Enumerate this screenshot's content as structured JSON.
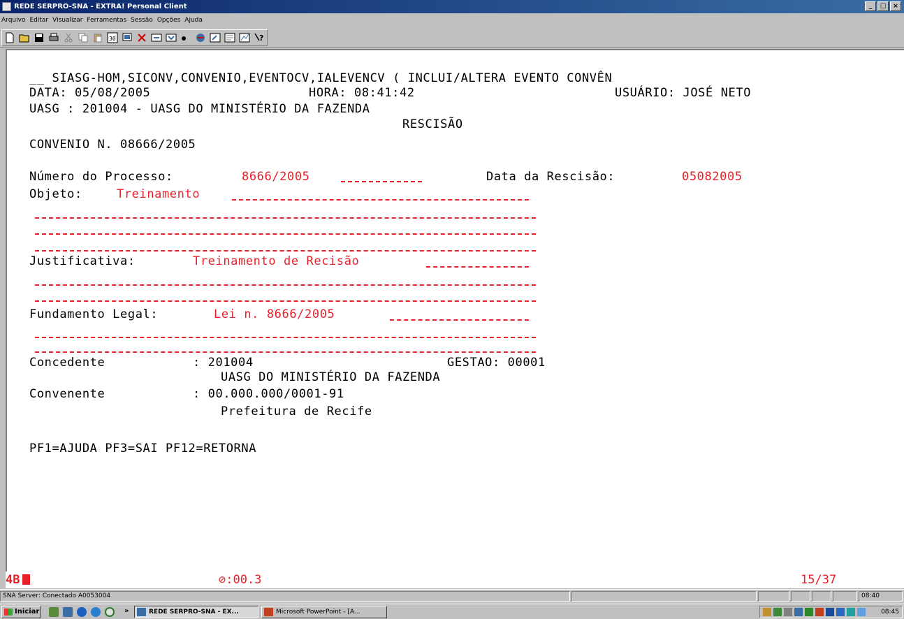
{
  "window": {
    "title": "REDE SERPRO-SNA - EXTRA! Personal Client"
  },
  "menu": [
    "Arquivo",
    "Editar",
    "Visualizar",
    "Ferramentas",
    "Sessão",
    "Opções",
    "Ajuda"
  ],
  "screen": {
    "header1": "__ SIASG-HOM,SICONV,CONVENIO,EVENTOCV,IALEVENCV ( INCLUI/ALTERA EVENTO CONVÊN",
    "date_label": "DATA: 05/08/2005",
    "time_label": "HORA: 08:41:42",
    "user_label": "USUÁRIO: JOSÉ NETO",
    "uasg_line": "UASG : 201004 - UASG DO MINISTÉRIO DA FAZENDA",
    "section_title": "RESCISÃO",
    "convenio_line": "CONVENIO N. 08666/2005",
    "processo_label": "Número do Processo:",
    "processo_value": "8666/2005",
    "rescisao_label": "Data da Rescisão:",
    "rescisao_value": "05082005",
    "objeto_label": "Objeto:",
    "objeto_value": "Treinamento",
    "justificativa_label": "Justificativa:",
    "justificativa_value": "Treinamento de Recisão",
    "fundamento_label": "Fundamento Legal:",
    "fundamento_value": "Lei n. 8666/2005",
    "concedente_label": "Concedente",
    "concedente_value": ": 201004",
    "gestao": "GESTAO: 00001",
    "concedente_name": "UASG DO MINISTÉRIO DA FAZENDA",
    "convenente_label": "Convenente",
    "convenente_value": ": 00.000.000/0001-91",
    "convenente_name": "Prefeitura de Recife",
    "pf_keys": "PF1=AJUDA PF3=SAI PF12=RETORNA"
  },
  "oia": {
    "session": "4B",
    "timer": "⊘:00.3",
    "cursor": "15/37"
  },
  "statusbar": {
    "connection": "SNA Server: Conectado A0053004",
    "time": "08:40"
  },
  "taskbar": {
    "start_label": "Iniciar",
    "chevron": "»",
    "task1": "REDE SERPRO-SNA - EX...",
    "task2": "Microsoft PowerPoint - [A...",
    "clock": "08:45"
  },
  "colors": {
    "field_red": "#e8202a",
    "titlebar": "#0a246a"
  }
}
